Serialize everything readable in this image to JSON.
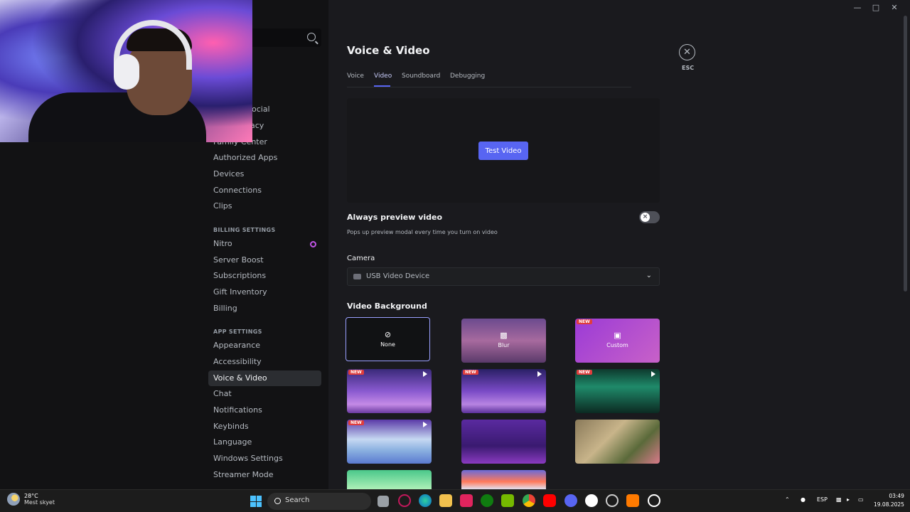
{
  "sidebar": {
    "items_top": [
      "Authorized Apps",
      "Devices",
      "Connections",
      "Clips"
    ],
    "partial_items": [
      "Social",
      "acy",
      "Family Center"
    ],
    "billing_header": "BILLING SETTINGS",
    "billing_items": [
      "Nitro",
      "Server Boost",
      "Subscriptions",
      "Gift Inventory",
      "Billing"
    ],
    "app_header": "APP SETTINGS",
    "app_items": [
      "Appearance",
      "Accessibility",
      "Voice & Video",
      "Chat",
      "Notifications",
      "Keybinds",
      "Language",
      "Windows Settings",
      "Streamer Mode"
    ]
  },
  "page": {
    "title": "Voice & Video",
    "tabs": [
      "Voice",
      "Video",
      "Soundboard",
      "Debugging"
    ],
    "active_tab": "Video",
    "close_label": "ESC"
  },
  "preview": {
    "test_button": "Test Video"
  },
  "always_preview": {
    "title": "Always preview video",
    "description": "Pops up preview modal every time you turn on video",
    "enabled": false
  },
  "camera": {
    "label": "Camera",
    "selected": "USB Video Device"
  },
  "video_background": {
    "title": "Video Background",
    "tiles": [
      {
        "label": "None",
        "icon": "none-icon",
        "new": false,
        "selected": true
      },
      {
        "label": "Blur",
        "icon": "blur-icon",
        "new": false
      },
      {
        "label": "Custom",
        "icon": "image-add-icon",
        "new": true
      },
      {
        "label": "",
        "new": true,
        "animated": true,
        "theme": "purple-castle"
      },
      {
        "label": "",
        "new": true,
        "animated": true,
        "theme": "purple-castle-2"
      },
      {
        "label": "",
        "new": true,
        "animated": true,
        "theme": "green-arcade"
      },
      {
        "label": "",
        "new": true,
        "animated": true,
        "theme": "snow-cove"
      },
      {
        "label": "",
        "new": false,
        "theme": "night-city"
      },
      {
        "label": "",
        "new": false,
        "theme": "garden-room"
      },
      {
        "label": "",
        "new": false,
        "theme": "green-meadow"
      },
      {
        "label": "",
        "new": false,
        "theme": "orange-robot"
      }
    ],
    "new_badge": "NEW"
  },
  "taskbar": {
    "weather_temp": "28°C",
    "weather_desc": "Mest skyet",
    "search_label": "Search",
    "language": "ESP",
    "time": "03:49",
    "date": "19.08.2025"
  },
  "colors": {
    "accent": "#5865f2",
    "sidebar_bg": "#121214",
    "main_bg": "#1a1a1e",
    "new_badge": "#e03d3d"
  }
}
